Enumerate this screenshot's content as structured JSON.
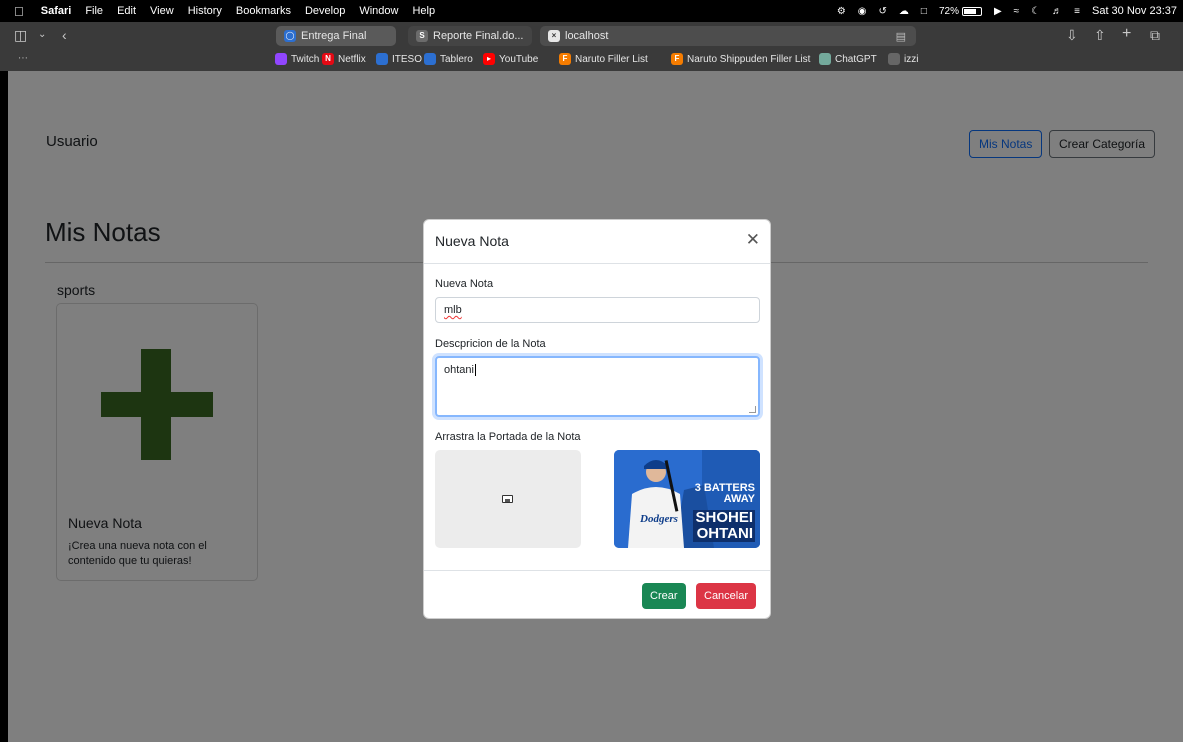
{
  "menubar": {
    "app": "Safari",
    "items": [
      "File",
      "Edit",
      "View",
      "History",
      "Bookmarks",
      "Develop",
      "Window",
      "Help"
    ],
    "battery": "72%",
    "datetime": "Sat 30 Nov  23:37"
  },
  "browser": {
    "tabs": [
      {
        "label": "Entrega Final",
        "icon": "shield-icon"
      },
      {
        "label": "Reporte Final.do...",
        "icon": "s-icon"
      },
      {
        "label": "localhost",
        "icon": "x-icon"
      }
    ],
    "bookmarks": [
      {
        "label": "Twitch",
        "icon": "twitch-icon",
        "color": "#9146ff"
      },
      {
        "label": "Netflix",
        "icon": "netflix-icon",
        "color": "#e50914"
      },
      {
        "label": "ITESO",
        "icon": "iteso-icon",
        "color": "#2c6fd1"
      },
      {
        "label": "Tablero",
        "icon": "tablero-icon",
        "color": "#2c6fd1"
      },
      {
        "label": "YouTube",
        "icon": "youtube-icon",
        "color": "#ff0000"
      },
      {
        "label": "Naruto Filler List",
        "icon": "filler-icon",
        "color": "#f57c00"
      },
      {
        "label": "Naruto Shippuden Filler List",
        "icon": "filler-icon",
        "color": "#f57c00"
      },
      {
        "label": "ChatGPT",
        "icon": "chatgpt-icon",
        "color": "#74aa9c"
      },
      {
        "label": "izzi",
        "icon": "izzi-icon",
        "color": "#666666"
      }
    ]
  },
  "page": {
    "brand": "Usuario",
    "nav_buttons": [
      "Mis Notas",
      "Crear Categoría"
    ],
    "heading": "Mis Notas",
    "category": "sports",
    "card": {
      "title": "Nueva Nota",
      "text": "¡Crea una nueva nota con el contenido que tu quieras!",
      "plus_color": "#3a6a23"
    }
  },
  "modal": {
    "title": "Nueva Nota",
    "name_label": "Nueva Nota",
    "name_value": "mlb",
    "desc_label": "Descpricion de la Nota",
    "desc_value": "ohtani",
    "cover_label": "Arrastra la Portada de la Nota",
    "cover_image": {
      "line1": "3 BATTERS",
      "line2": "AWAY",
      "name1": "SHOHEI",
      "name2": "OHTANI"
    },
    "submit": "Crear",
    "cancel": "Cancelar",
    "colors": {
      "submit": "#198754",
      "cancel": "#dc3545"
    }
  }
}
